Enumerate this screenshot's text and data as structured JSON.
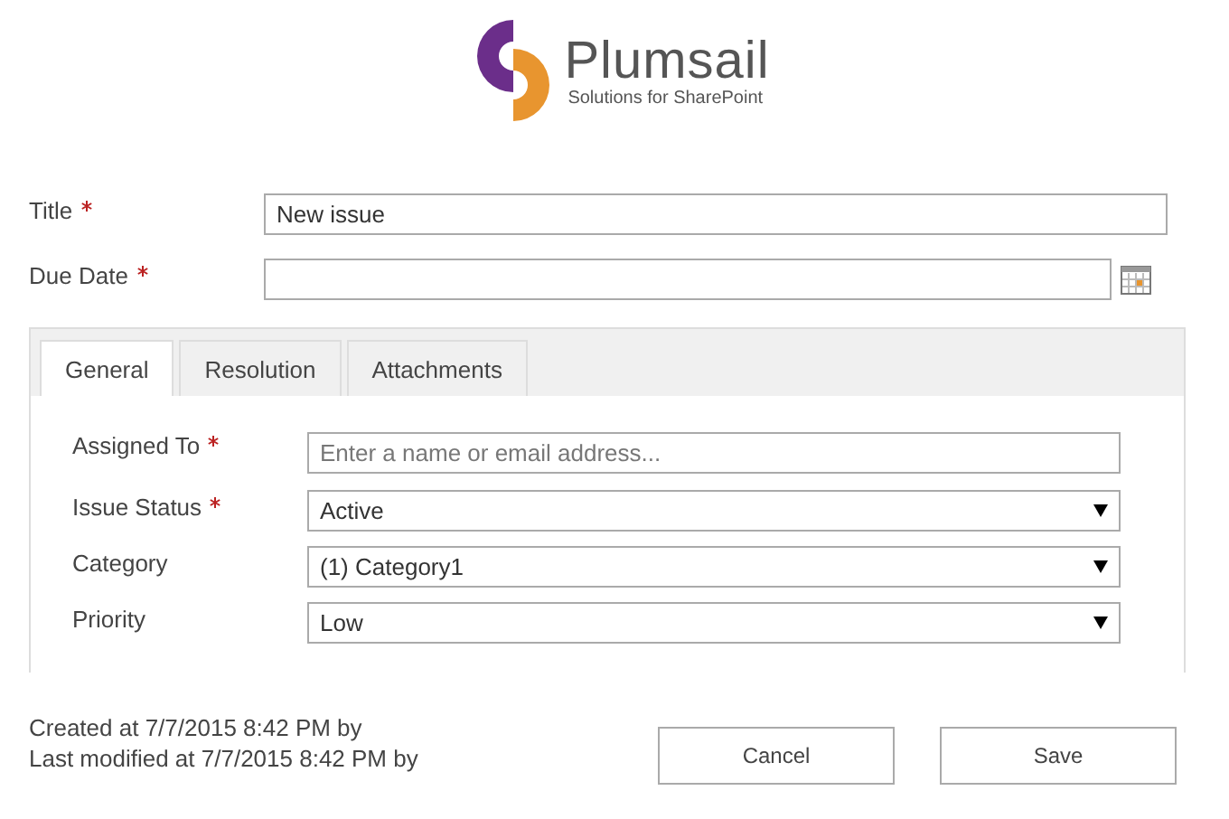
{
  "logo": {
    "name": "Plumsail",
    "tagline": "Solutions for SharePoint"
  },
  "fields": [
    {
      "label": "Title",
      "required": true,
      "kind": "text",
      "value": "New issue"
    },
    {
      "label": "Due Date",
      "required": true,
      "kind": "date"
    }
  ],
  "tabs": [
    {
      "label": "General",
      "selected": true
    },
    {
      "label": "Resolution",
      "selected": false
    },
    {
      "label": "Attachments",
      "selected": false
    }
  ],
  "tab_fields": [
    {
      "label": "Assigned To",
      "required": true,
      "kind": "people",
      "placeholder": "Enter a name or email address..."
    },
    {
      "label": "Issue Status",
      "required": true,
      "kind": "select",
      "value": "Active"
    },
    {
      "label": "Category",
      "required": false,
      "kind": "select",
      "value": "(1) Category1"
    },
    {
      "label": "Priority",
      "required": false,
      "kind": "select",
      "value": "Low"
    }
  ],
  "footer": {
    "created": "Created at 7/7/2015 8:42 PM by",
    "modified": "Last modified at 7/7/2015 8:42 PM by",
    "buttons": [
      "Cancel",
      "Save"
    ]
  }
}
